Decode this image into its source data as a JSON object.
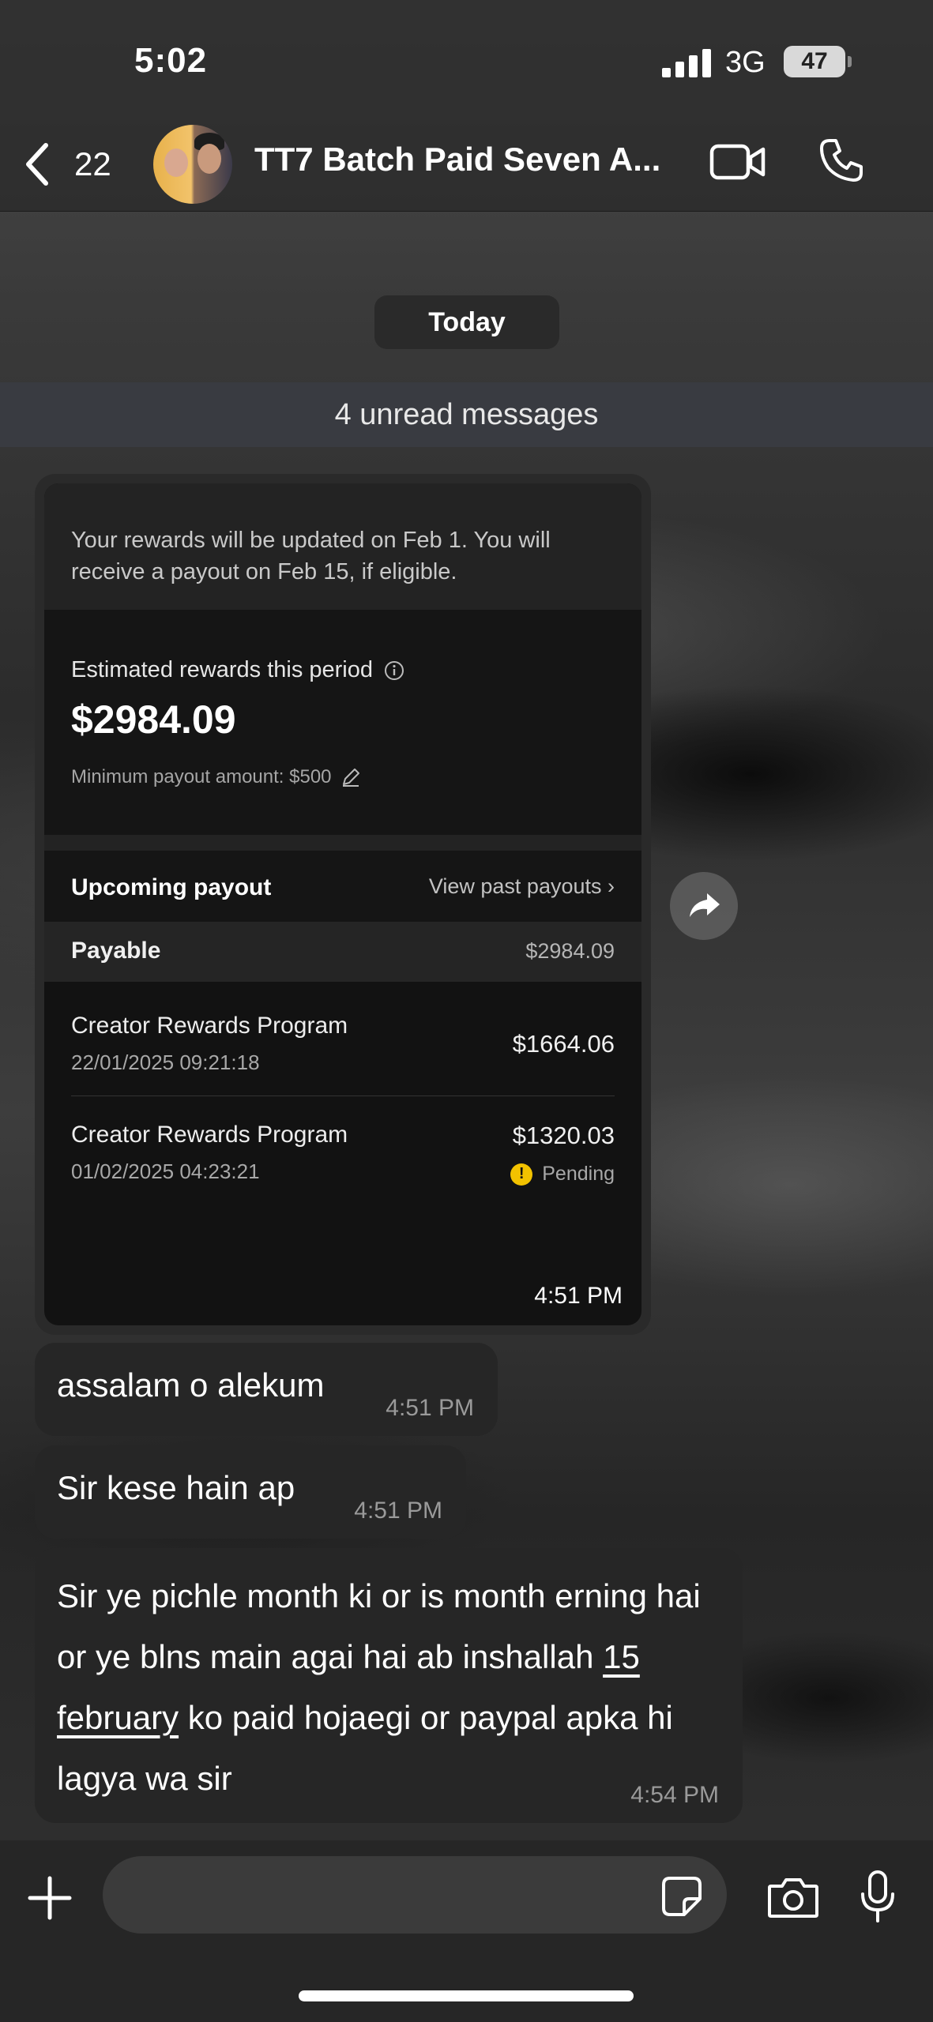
{
  "status_bar": {
    "time": "5:02",
    "network": "3G",
    "battery": "47"
  },
  "header": {
    "back_count": "22",
    "title": "TT7 Batch Paid Seven A..."
  },
  "date_pill": "Today",
  "unread_banner": "4 unread messages",
  "image_message": {
    "notice": "Your rewards will be updated on Feb 1. You will receive a payout on Feb 15, if eligible.",
    "estimated_label": "Estimated rewards this period",
    "estimated_amount": "$2984.09",
    "min_payout": "Minimum payout amount: $500",
    "upcoming_label": "Upcoming payout",
    "view_past": "View past payouts ›",
    "payable_label": "Payable",
    "payable_amount": "$2984.09",
    "payouts": [
      {
        "name": "Creator Rewards Program",
        "date": "22/01/2025 09:21:18",
        "amount": "$1664.06"
      },
      {
        "name": "Creator Rewards Program",
        "date": "01/02/2025 04:23:21",
        "amount": "$1320.03",
        "status": "Pending"
      }
    ],
    "time": "4:51 PM"
  },
  "messages": [
    {
      "text": "assalam o alekum",
      "time": "4:51 PM"
    },
    {
      "text": "Sir kese hain ap",
      "time": "4:51 PM"
    },
    {
      "text_part1": "Sir ye pichle month ki or is month erning hai or ye blns main agai hai ab inshallah ",
      "text_link": "15 february",
      "text_part2": " ko paid hojaegi or paypal apka hi lagya wa sir",
      "time": "4:54 PM"
    }
  ],
  "composer": {
    "placeholder": ""
  },
  "colors": {
    "bubble": "#262626",
    "pending_warning": "#f2c200"
  }
}
